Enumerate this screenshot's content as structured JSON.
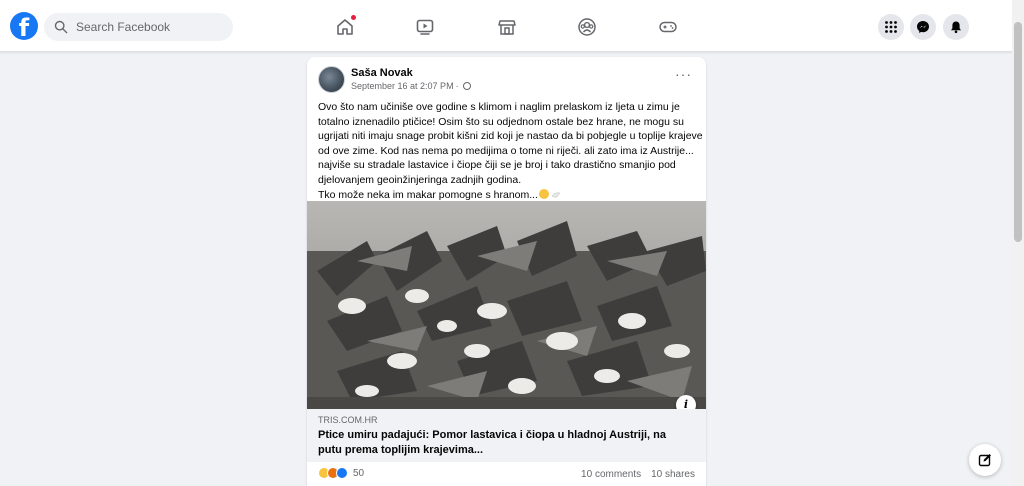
{
  "topbar": {
    "logo": "f",
    "search_placeholder": "Search Facebook",
    "nav_icons": [
      "home-icon",
      "video-icon",
      "marketplace-icon",
      "groups-icon",
      "gaming-icon"
    ],
    "right_icons": [
      "menu-grid-icon",
      "messenger-icon",
      "bell-icon"
    ],
    "accent_color": "#1877f2",
    "notification_color": "#e41e3f"
  },
  "post": {
    "author": "Saša Novak",
    "timestamp": "September 16 at 2:07 PM",
    "separator": "·",
    "more": "···",
    "text_lines": [
      "Ovo što nam učiniše ove godine s klimom i naglim prelaskom iz ljeta u zimu je",
      "totalno iznenadilo ptičice! Osim što su odjednom ostale bez hrane, ne mogu su",
      "ugrijati niti imaju snage probit kišni zid koji je nastao da bi pobjegle u toplije krajeve",
      "od ove zime. Kod nas nema po medijima o tome ni riječi. ali zato ima iz Austrije...",
      "najviše su stradale lastavice i čiope čiji se je broj i tako drastično smanjio pod",
      "djelovanjem geoinžinjeringa zadnjih godina.",
      "Tko može neka im makar pomogne s hranom..."
    ],
    "image_info": "i",
    "link": {
      "domain": "TRIS.COM.HR",
      "title_line1": "Ptice umiru padajući: Pomor lastavica i čiopa u hladnoj Austriji, na",
      "title_line2": "putu prema toplijim krajevima..."
    },
    "reactions": {
      "types": [
        "sad",
        "angry",
        "like"
      ],
      "count": "50"
    },
    "comments": "10 comments",
    "shares": "10 shares"
  }
}
